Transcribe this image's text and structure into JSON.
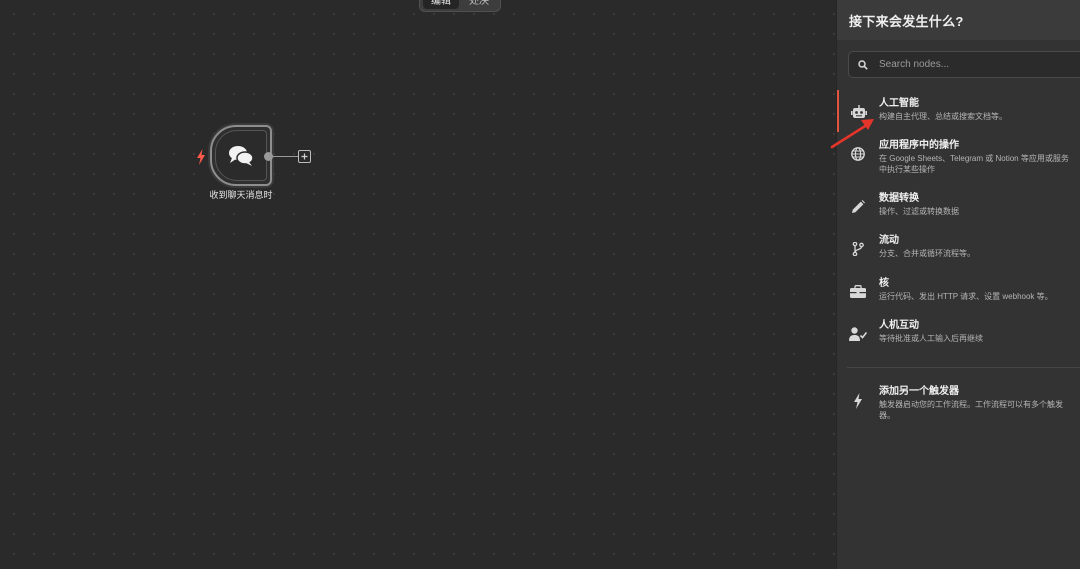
{
  "canvas": {
    "mode_tabs": [
      {
        "label": "编辑",
        "active": true
      },
      {
        "label": "处决",
        "active": false
      }
    ],
    "node": {
      "label": "收到聊天消息时",
      "icon": "chat-bubbles-icon",
      "trigger_icon": "lightning-bolt-icon"
    }
  },
  "panel": {
    "title": "接下来会发生什么?",
    "search": {
      "placeholder": "Search nodes...",
      "value": ""
    },
    "items": [
      {
        "title": "人工智能",
        "desc": "构建自主代理、总结或搜索文档等。",
        "icon": "robot-icon",
        "selected": true
      },
      {
        "title": "应用程序中的操作",
        "desc": "在 Google Sheets、Telegram 或 Notion 等应用或服务中执行某些操作",
        "icon": "globe-icon",
        "selected": false
      },
      {
        "title": "数据转换",
        "desc": "操作、过滤或转换数据",
        "icon": "pencil-icon",
        "selected": false
      },
      {
        "title": "流动",
        "desc": "分支、合并或循环流程等。",
        "icon": "branch-icon",
        "selected": false
      },
      {
        "title": "核",
        "desc": "运行代码、发出 HTTP 请求、设置 webhook 等。",
        "icon": "toolbox-icon",
        "selected": false
      },
      {
        "title": "人机互动",
        "desc": "等待批准或人工输入后再继续",
        "icon": "user-check-icon",
        "selected": false
      }
    ],
    "trigger_item": {
      "title": "添加另一个触发器",
      "desc": "触发器启动您的工作流程。工作流程可以有多个触发器。",
      "icon": "lightning-bolt-icon"
    }
  },
  "colors": {
    "accent": "#e0553f",
    "panel_bg": "#333333",
    "canvas_bg": "#2a2a2a"
  }
}
